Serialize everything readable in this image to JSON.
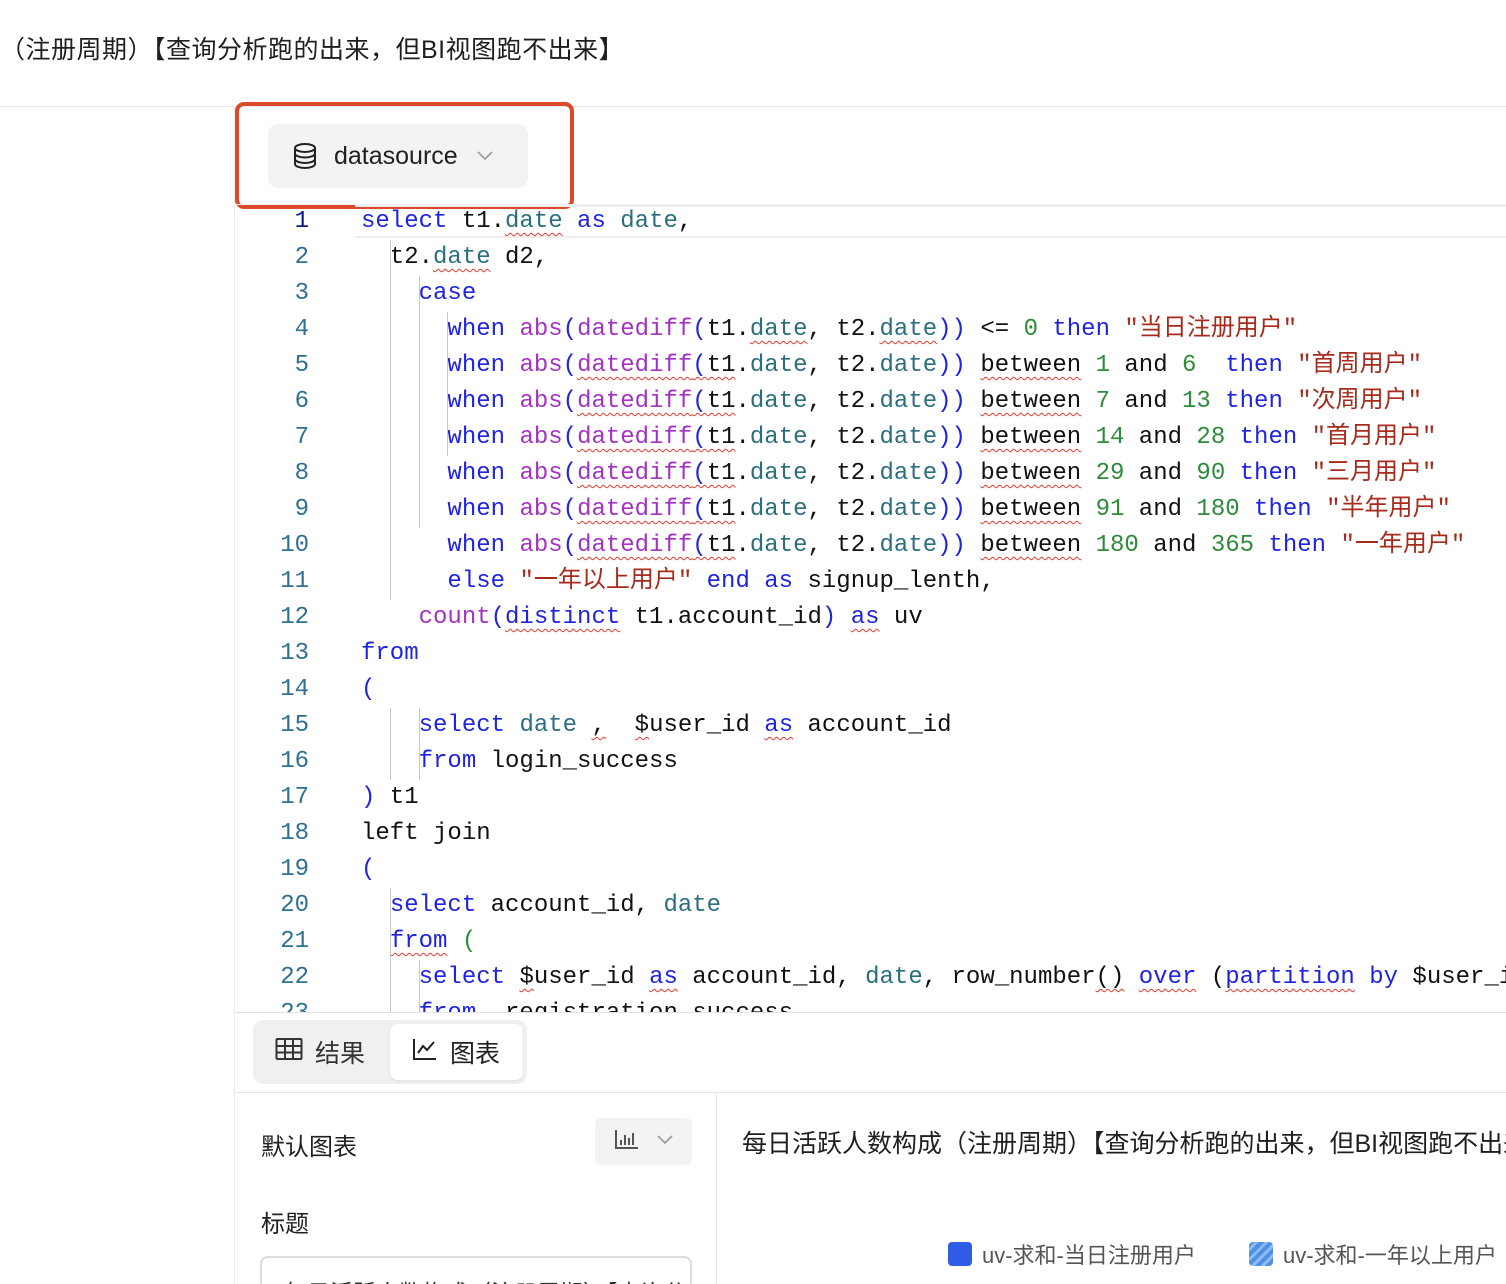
{
  "page": {
    "title": "（注册周期）【查询分析跑的出来，但BI视图跑不出来】"
  },
  "datasource": {
    "label": "datasource",
    "icon": "database-icon"
  },
  "editor": {
    "lines": [
      {
        "n": "1",
        "active": true,
        "tokens": [
          [
            "select",
            "k"
          ],
          [
            " t1.",
            ""
          ],
          [
            "date",
            "c w"
          ],
          [
            " ",
            ""
          ],
          [
            "as",
            "k"
          ],
          [
            " ",
            ""
          ],
          [
            "date",
            "c"
          ],
          [
            ",",
            ""
          ]
        ]
      },
      {
        "n": "2",
        "tokens": [
          [
            "  t2.",
            ""
          ],
          [
            "date",
            "c w"
          ],
          [
            " d2,",
            ""
          ]
        ]
      },
      {
        "n": "3",
        "tokens": [
          [
            "    ",
            ""
          ],
          [
            "case",
            "k"
          ]
        ]
      },
      {
        "n": "4",
        "tokens": [
          [
            "      ",
            ""
          ],
          [
            "when",
            "k"
          ],
          [
            " ",
            ""
          ],
          [
            "abs",
            "f"
          ],
          [
            "(",
            "k"
          ],
          [
            "datediff",
            "f"
          ],
          [
            "(",
            "k"
          ],
          [
            "t1.",
            ""
          ],
          [
            "date",
            "c w"
          ],
          [
            ", t2.",
            ""
          ],
          [
            "date",
            "c w"
          ],
          [
            "))",
            "k"
          ],
          [
            " <= ",
            ""
          ],
          [
            "0",
            "n"
          ],
          [
            " ",
            ""
          ],
          [
            "then",
            "k"
          ],
          [
            " ",
            ""
          ],
          [
            "\"当日注册用户\"",
            "s"
          ]
        ]
      },
      {
        "n": "5",
        "tokens": [
          [
            "      ",
            ""
          ],
          [
            "when",
            "k"
          ],
          [
            " ",
            ""
          ],
          [
            "abs",
            "f"
          ],
          [
            "(",
            "k"
          ],
          [
            "datediff",
            "f w"
          ],
          [
            "(",
            "k w"
          ],
          [
            "t1",
            "w"
          ],
          [
            ".",
            ""
          ],
          [
            "date",
            "c"
          ],
          [
            ", t2.",
            ""
          ],
          [
            "date",
            "c"
          ],
          [
            "))",
            "k"
          ],
          [
            " ",
            ""
          ],
          [
            "between",
            "w"
          ],
          [
            " ",
            ""
          ],
          [
            "1",
            "n"
          ],
          [
            " and ",
            ""
          ],
          [
            "6",
            "n"
          ],
          [
            "  ",
            ""
          ],
          [
            "then",
            "k"
          ],
          [
            " ",
            ""
          ],
          [
            "\"首周用户\"",
            "s"
          ]
        ]
      },
      {
        "n": "6",
        "tokens": [
          [
            "      ",
            ""
          ],
          [
            "when",
            "k"
          ],
          [
            " ",
            ""
          ],
          [
            "abs",
            "f"
          ],
          [
            "(",
            "k"
          ],
          [
            "datediff",
            "f w"
          ],
          [
            "(",
            "k w"
          ],
          [
            "t1",
            "w"
          ],
          [
            ".",
            ""
          ],
          [
            "date",
            "c"
          ],
          [
            ", t2.",
            ""
          ],
          [
            "date",
            "c"
          ],
          [
            "))",
            "k"
          ],
          [
            " ",
            ""
          ],
          [
            "between",
            "w"
          ],
          [
            " ",
            ""
          ],
          [
            "7",
            "n"
          ],
          [
            " and ",
            ""
          ],
          [
            "13",
            "n"
          ],
          [
            " ",
            ""
          ],
          [
            "then",
            "k"
          ],
          [
            " ",
            ""
          ],
          [
            "\"次周用户\"",
            "s"
          ]
        ]
      },
      {
        "n": "7",
        "tokens": [
          [
            "      ",
            ""
          ],
          [
            "when",
            "k"
          ],
          [
            " ",
            ""
          ],
          [
            "abs",
            "f"
          ],
          [
            "(",
            "k"
          ],
          [
            "datediff",
            "f w"
          ],
          [
            "(",
            "k w"
          ],
          [
            "t1",
            "w"
          ],
          [
            ".",
            ""
          ],
          [
            "date",
            "c"
          ],
          [
            ", t2.",
            ""
          ],
          [
            "date",
            "c"
          ],
          [
            "))",
            "k"
          ],
          [
            " ",
            ""
          ],
          [
            "between",
            "w"
          ],
          [
            " ",
            ""
          ],
          [
            "14",
            "n"
          ],
          [
            " and ",
            ""
          ],
          [
            "28",
            "n"
          ],
          [
            " ",
            ""
          ],
          [
            "then",
            "k"
          ],
          [
            " ",
            ""
          ],
          [
            "\"首月用户\"",
            "s"
          ]
        ]
      },
      {
        "n": "8",
        "tokens": [
          [
            "      ",
            ""
          ],
          [
            "when",
            "k"
          ],
          [
            " ",
            ""
          ],
          [
            "abs",
            "f"
          ],
          [
            "(",
            "k"
          ],
          [
            "datediff",
            "f w"
          ],
          [
            "(",
            "k w"
          ],
          [
            "t1",
            "w"
          ],
          [
            ".",
            ""
          ],
          [
            "date",
            "c"
          ],
          [
            ", t2.",
            ""
          ],
          [
            "date",
            "c"
          ],
          [
            "))",
            "k"
          ],
          [
            " ",
            ""
          ],
          [
            "between",
            "w"
          ],
          [
            " ",
            ""
          ],
          [
            "29",
            "n"
          ],
          [
            " and ",
            ""
          ],
          [
            "90",
            "n"
          ],
          [
            " ",
            ""
          ],
          [
            "then",
            "k"
          ],
          [
            " ",
            ""
          ],
          [
            "\"三月用户\"",
            "s"
          ]
        ]
      },
      {
        "n": "9",
        "tokens": [
          [
            "      ",
            ""
          ],
          [
            "when",
            "k"
          ],
          [
            " ",
            ""
          ],
          [
            "abs",
            "f"
          ],
          [
            "(",
            "k"
          ],
          [
            "datediff",
            "f w"
          ],
          [
            "(",
            "k w"
          ],
          [
            "t1",
            "w"
          ],
          [
            ".",
            ""
          ],
          [
            "date",
            "c"
          ],
          [
            ", t2.",
            ""
          ],
          [
            "date",
            "c"
          ],
          [
            "))",
            "k"
          ],
          [
            " ",
            ""
          ],
          [
            "between",
            "w"
          ],
          [
            " ",
            ""
          ],
          [
            "91",
            "n"
          ],
          [
            " and ",
            ""
          ],
          [
            "180",
            "n"
          ],
          [
            " ",
            ""
          ],
          [
            "then",
            "k"
          ],
          [
            " ",
            ""
          ],
          [
            "\"半年用户\"",
            "s"
          ]
        ]
      },
      {
        "n": "10",
        "tokens": [
          [
            "      ",
            ""
          ],
          [
            "when",
            "k"
          ],
          [
            " ",
            ""
          ],
          [
            "abs",
            "f"
          ],
          [
            "(",
            "k"
          ],
          [
            "datediff",
            "f w"
          ],
          [
            "(",
            "k w"
          ],
          [
            "t1",
            "w"
          ],
          [
            ".",
            ""
          ],
          [
            "date",
            "c"
          ],
          [
            ", t2.",
            ""
          ],
          [
            "date",
            "c"
          ],
          [
            "))",
            "k"
          ],
          [
            " ",
            ""
          ],
          [
            "between",
            "w"
          ],
          [
            " ",
            ""
          ],
          [
            "180",
            "n"
          ],
          [
            " and ",
            ""
          ],
          [
            "365",
            "n"
          ],
          [
            " ",
            ""
          ],
          [
            "then",
            "k"
          ],
          [
            " ",
            ""
          ],
          [
            "\"一年用户\"",
            "s"
          ]
        ]
      },
      {
        "n": "11",
        "tokens": [
          [
            "      ",
            ""
          ],
          [
            "else",
            "k"
          ],
          [
            " ",
            ""
          ],
          [
            "\"一年以上用户\"",
            "s"
          ],
          [
            " ",
            ""
          ],
          [
            "end",
            "k"
          ],
          [
            " ",
            ""
          ],
          [
            "as",
            "k"
          ],
          [
            " signup_lenth,",
            ""
          ]
        ]
      },
      {
        "n": "12",
        "tokens": [
          [
            "    ",
            ""
          ],
          [
            "count",
            "f"
          ],
          [
            "(",
            "k"
          ],
          [
            "distinct",
            "k w"
          ],
          [
            " t1.account_id",
            ""
          ],
          [
            ")",
            "k"
          ],
          [
            " ",
            ""
          ],
          [
            "as",
            "k w"
          ],
          [
            " uv",
            ""
          ]
        ]
      },
      {
        "n": "13",
        "tokens": [
          [
            "from",
            "k"
          ]
        ]
      },
      {
        "n": "14",
        "tokens": [
          [
            "(",
            "k"
          ]
        ]
      },
      {
        "n": "15",
        "tokens": [
          [
            "    ",
            ""
          ],
          [
            "select",
            "k"
          ],
          [
            " ",
            ""
          ],
          [
            "date",
            "c"
          ],
          [
            " ",
            ""
          ],
          [
            ",",
            "w"
          ],
          [
            "  ",
            ""
          ],
          [
            "$",
            "w"
          ],
          [
            "user_id ",
            ""
          ],
          [
            "as",
            "k w"
          ],
          [
            " account_id",
            ""
          ]
        ]
      },
      {
        "n": "16",
        "tokens": [
          [
            "    ",
            ""
          ],
          [
            "from",
            "k"
          ],
          [
            " login_success",
            ""
          ]
        ]
      },
      {
        "n": "17",
        "tokens": [
          [
            ")",
            "k"
          ],
          [
            " t1",
            ""
          ]
        ]
      },
      {
        "n": "18",
        "tokens": [
          [
            "left join",
            ""
          ]
        ]
      },
      {
        "n": "19",
        "tokens": [
          [
            "(",
            "k"
          ]
        ]
      },
      {
        "n": "20",
        "tokens": [
          [
            "  ",
            ""
          ],
          [
            "select",
            "k"
          ],
          [
            " account_id, ",
            ""
          ],
          [
            "date",
            "c"
          ]
        ]
      },
      {
        "n": "21",
        "tokens": [
          [
            "  ",
            ""
          ],
          [
            "from",
            "k w"
          ],
          [
            " ",
            ""
          ],
          [
            "(",
            "n"
          ]
        ]
      },
      {
        "n": "22",
        "tokens": [
          [
            "    ",
            ""
          ],
          [
            "select",
            "k"
          ],
          [
            " ",
            ""
          ],
          [
            "$",
            "w"
          ],
          [
            "user_id ",
            ""
          ],
          [
            "as",
            "k w"
          ],
          [
            " account_id, ",
            ""
          ],
          [
            "date",
            "c"
          ],
          [
            ", row_number",
            ""
          ],
          [
            "()",
            "w"
          ],
          [
            " ",
            ""
          ],
          [
            "over",
            "k w"
          ],
          [
            " (",
            ""
          ],
          [
            "partition",
            "k w"
          ],
          [
            " ",
            ""
          ],
          [
            "by",
            "k"
          ],
          [
            " $user_id",
            ""
          ]
        ]
      },
      {
        "n": "23",
        "tokens": [
          [
            "    ",
            ""
          ],
          [
            "from",
            "k w"
          ],
          [
            "  registration_success",
            ""
          ]
        ]
      }
    ]
  },
  "result_tabs": [
    {
      "label": "结果",
      "icon": "table-icon"
    },
    {
      "label": "图表",
      "icon": "line-chart-icon",
      "selected": true
    }
  ],
  "config": {
    "default_chart_label": "默认图表",
    "chart_type_icon": "bar-chart-icon",
    "title_label": "标题",
    "title_value": "每日活跃人数构成（注册周期）【查询分析跑的出来，但BI视图跑不出来】"
  },
  "chart": {
    "title": "每日活跃人数构成（注册周期）【查询分析跑的出来，但BI视图跑不出来】",
    "legend": [
      {
        "label": "uv-求和-当日注册用户",
        "color": "#2f5ce6",
        "pattern": "solid"
      },
      {
        "label": "uv-求和-一年以上用户",
        "color": "#5b9be6",
        "pattern": "hatched"
      }
    ]
  }
}
